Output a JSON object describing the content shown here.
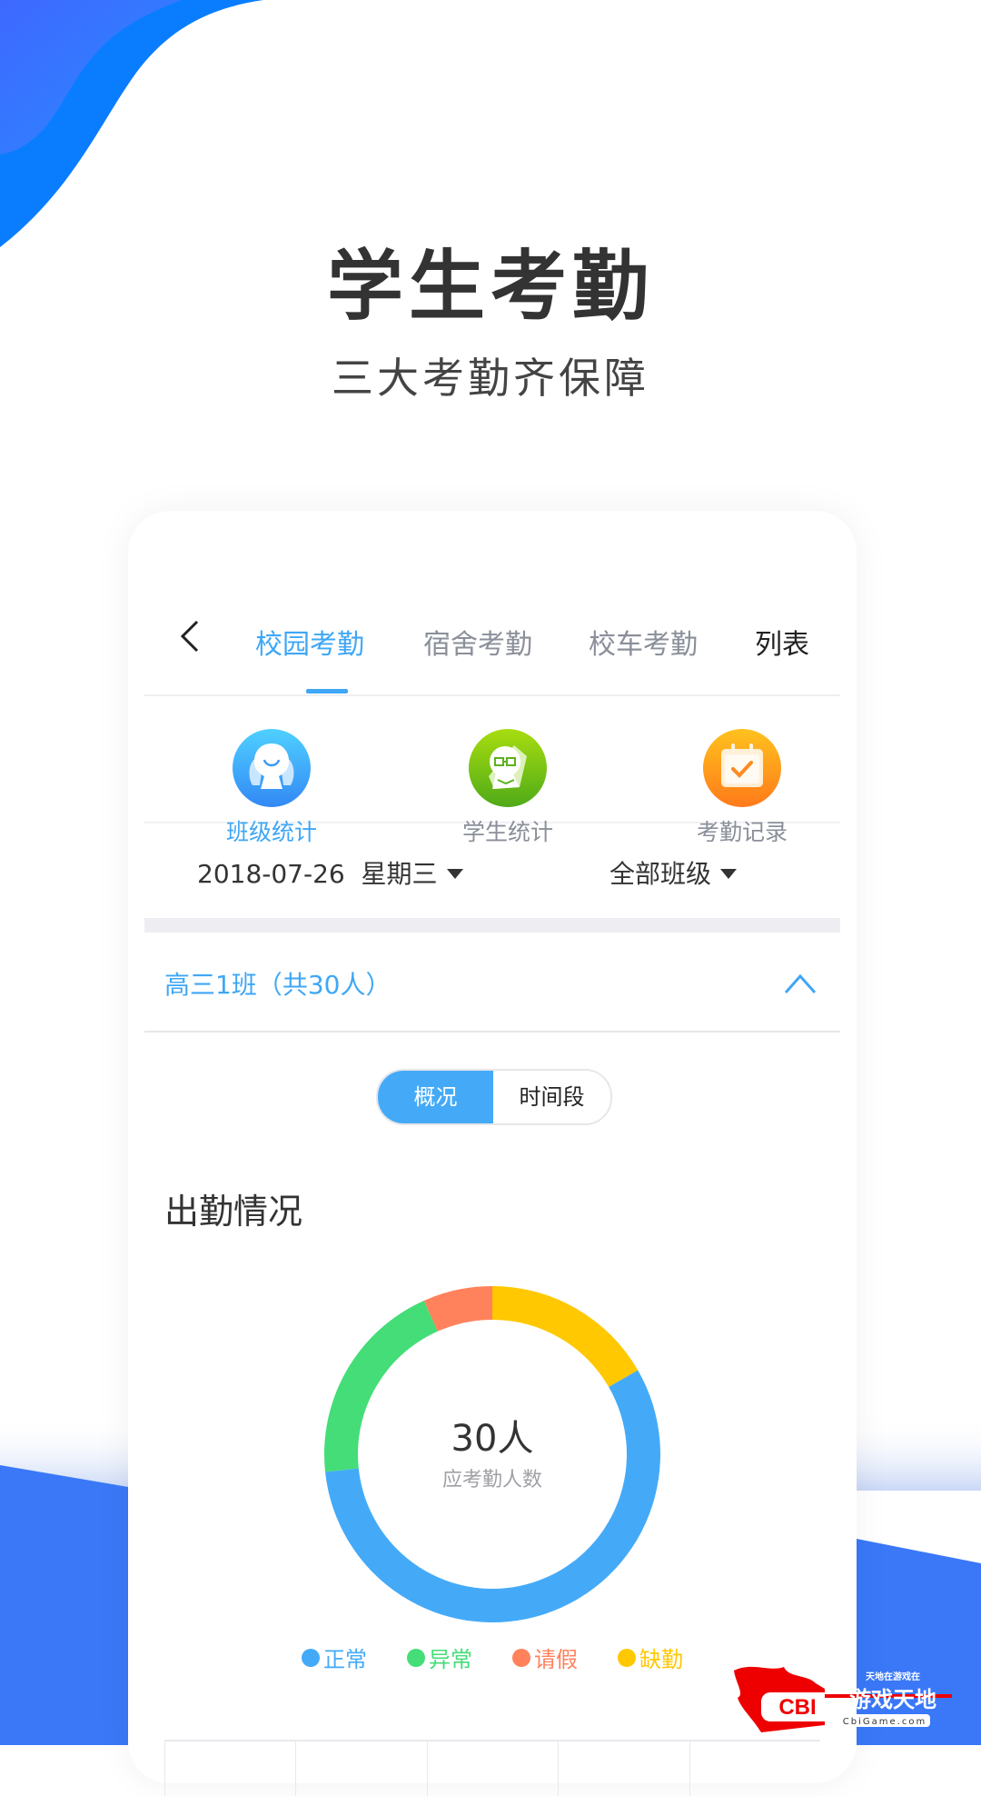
{
  "hero": {
    "title": "学生考勤",
    "subtitle": "三大考勤齐保障"
  },
  "nav": {
    "back_icon": "chevron-left-icon",
    "tabs": [
      {
        "label": "校园考勤",
        "active": true
      },
      {
        "label": "宿舍考勤",
        "active": false
      },
      {
        "label": "校车考勤",
        "active": false
      }
    ],
    "list_label": "列表"
  },
  "quick_actions": [
    {
      "label": "班级统计",
      "icon": "class-stats-icon",
      "color": "#3fa7f5",
      "active": true
    },
    {
      "label": "学生统计",
      "icon": "student-stats-icon",
      "color": "#66bb22",
      "active": false
    },
    {
      "label": "考勤记录",
      "icon": "attendance-record-icon",
      "color": "#ff9a1f",
      "active": false
    }
  ],
  "filters": {
    "date": "2018-07-26",
    "weekday": "星期三",
    "class_select": "全部班级"
  },
  "class_group": {
    "title": "高三1班（共30人）",
    "expanded": true
  },
  "segmented": {
    "options": [
      "概况",
      "时间段"
    ],
    "selected": "概况"
  },
  "section_title": "出勤情况",
  "donut_center": {
    "value": "30人",
    "label": "应考勤人数"
  },
  "chart_data": {
    "type": "pie",
    "variant": "donut",
    "title": "出勤情况",
    "total": 30,
    "start": "top",
    "direction": "clockwise",
    "categories": [
      "缺勤",
      "正常",
      "异常",
      "请假"
    ],
    "values": [
      5,
      17,
      6,
      2
    ],
    "colors": [
      "#ffc800",
      "#44aaf8",
      "#44dd77",
      "#ff825c"
    ],
    "legend": [
      {
        "label": "正常",
        "color": "#44aaf8"
      },
      {
        "label": "异常",
        "color": "#44dd77"
      },
      {
        "label": "请假",
        "color": "#ff825c"
      },
      {
        "label": "缺勤",
        "color": "#ffc800"
      }
    ],
    "legend_position": "bottom"
  },
  "colors": {
    "accent": "#3fa7f5",
    "brand_blue": "#0a7dff",
    "text_dark": "#333333",
    "text_muted": "#8a8f99"
  },
  "watermark": {
    "logo": "CBI",
    "text": "游戏天地",
    "small_text": "天地在游戏在",
    "url_text": "CbiGame.com"
  }
}
